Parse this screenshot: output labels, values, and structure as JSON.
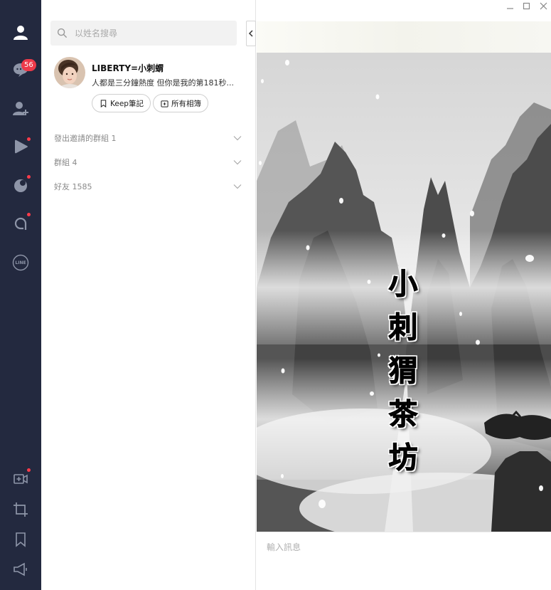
{
  "sidebar": {
    "chat_badge": "56"
  },
  "search": {
    "placeholder": "以姓名搜尋"
  },
  "profile": {
    "name": "LIBERTY=小刺蝟",
    "status": "人都是三分鐘熱度 但你是我的第181秒...",
    "keep_label": "Keep筆記",
    "album_label": "所有相簿"
  },
  "groups": [
    {
      "label": "發出邀請的群組 1"
    },
    {
      "label": "群組 4"
    },
    {
      "label": "好友 1585"
    }
  ],
  "chat": {
    "background_text": "小刺猬茶坊",
    "input_placeholder": "輸入訊息"
  },
  "colors": {
    "rail_bg": "#23293f",
    "badge": "#ee3a4a",
    "notify_dot": "#ff3b4a"
  }
}
